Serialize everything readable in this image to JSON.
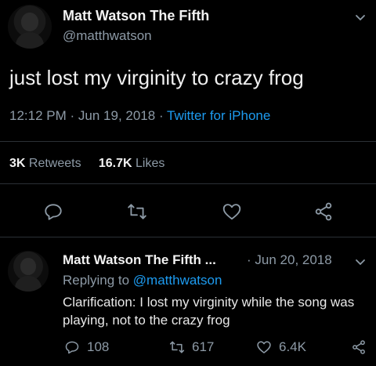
{
  "tweet": {
    "author_name": "Matt Watson The Fifth",
    "handle": "@matthwatson",
    "text": "just lost my virginity to crazy frog",
    "time": "12:12 PM",
    "date": "Jun 19, 2018",
    "separator": "·",
    "source": "Twitter for iPhone",
    "retweets_count": "3K",
    "retweets_label": "Retweets",
    "likes_count": "16.7K",
    "likes_label": "Likes"
  },
  "reply": {
    "author_name": "Matt Watson The Fifth ...",
    "date_sep": "·",
    "date": "Jun 20, 2018",
    "replying_prefix": "Replying to",
    "replying_handle": "@matthwatson",
    "text": "Clarification: I lost my virginity while the song was playing, not to the crazy frog",
    "reply_count": "108",
    "retweet_count": "617",
    "like_count": "6.4K"
  },
  "colors": {
    "background": "#000000",
    "accent": "#1d9bf0",
    "muted": "#8d9aa6",
    "divider": "#2b3036"
  },
  "icons": [
    "chevron-down-icon",
    "reply-icon",
    "retweet-icon",
    "heart-icon",
    "share-icon"
  ]
}
